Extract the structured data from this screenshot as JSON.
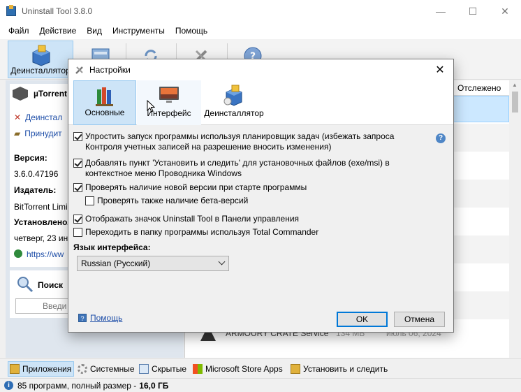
{
  "window": {
    "title": "Uninstall Tool 3.8.0",
    "controls": {
      "minimize": "—",
      "maximize": "☐",
      "close": "✕"
    }
  },
  "menu": [
    "Файл",
    "Действие",
    "Вид",
    "Инструменты",
    "Помощь"
  ],
  "toolbar": {
    "uninstaller_label": "Деинсталлятор"
  },
  "program": {
    "name": "µTorrent",
    "actions": [
      "Деинстал",
      "Принудит"
    ],
    "version_label": "Версия:",
    "version": "3.6.0.47196",
    "publisher_label": "Издатель:",
    "publisher": "BitTorrent Limi",
    "installed_label": "Установлено/",
    "installed": "четверг, 23 ин",
    "website": "https://ww"
  },
  "search": {
    "title": "Поиск",
    "placeholder": "Введи"
  },
  "list": {
    "column_tracked": "Отслежено",
    "visible_row": {
      "name": "ARMOURY CRATE Service",
      "size": "134 МБ",
      "date": "июль 06, 2024"
    }
  },
  "tabs": [
    "Приложения",
    "Системные",
    "Скрытые",
    "Microsoft Store Apps",
    "Установить и следить"
  ],
  "status": {
    "text": "85 программ, полный размер -",
    "size": "16,0 ГБ"
  },
  "dialog": {
    "title": "Настройки",
    "tabs": [
      "Основные",
      "Интерфейс",
      "Деинсталлятор"
    ],
    "options": [
      {
        "label1": "Упростить запуск программы используя планировщик задач (избежать запроса",
        "label2": "Контроля учетных записей на разрешение вносить изменения)",
        "checked": true
      },
      {
        "label1": "Добавлять пункт 'Установить и следить' для установочных файлов (exe/msi) в",
        "label2": "контекстное меню Проводника Windows",
        "checked": true
      },
      {
        "label1": "Проверять наличие новой версии при старте программы",
        "checked": true
      },
      {
        "label1": "Проверять также наличие бета-версий",
        "checked": false
      },
      {
        "label1": "Отображать значок Uninstall Tool в Панели управления",
        "checked": true
      },
      {
        "label1": "Переходить в папку программы используя Total Commander",
        "checked": false
      }
    ],
    "language_label": "Язык интерфейса:",
    "language_value": "Russian (Русский)",
    "help_link": "Помощь",
    "ok": "OK",
    "cancel": "Отмена"
  }
}
